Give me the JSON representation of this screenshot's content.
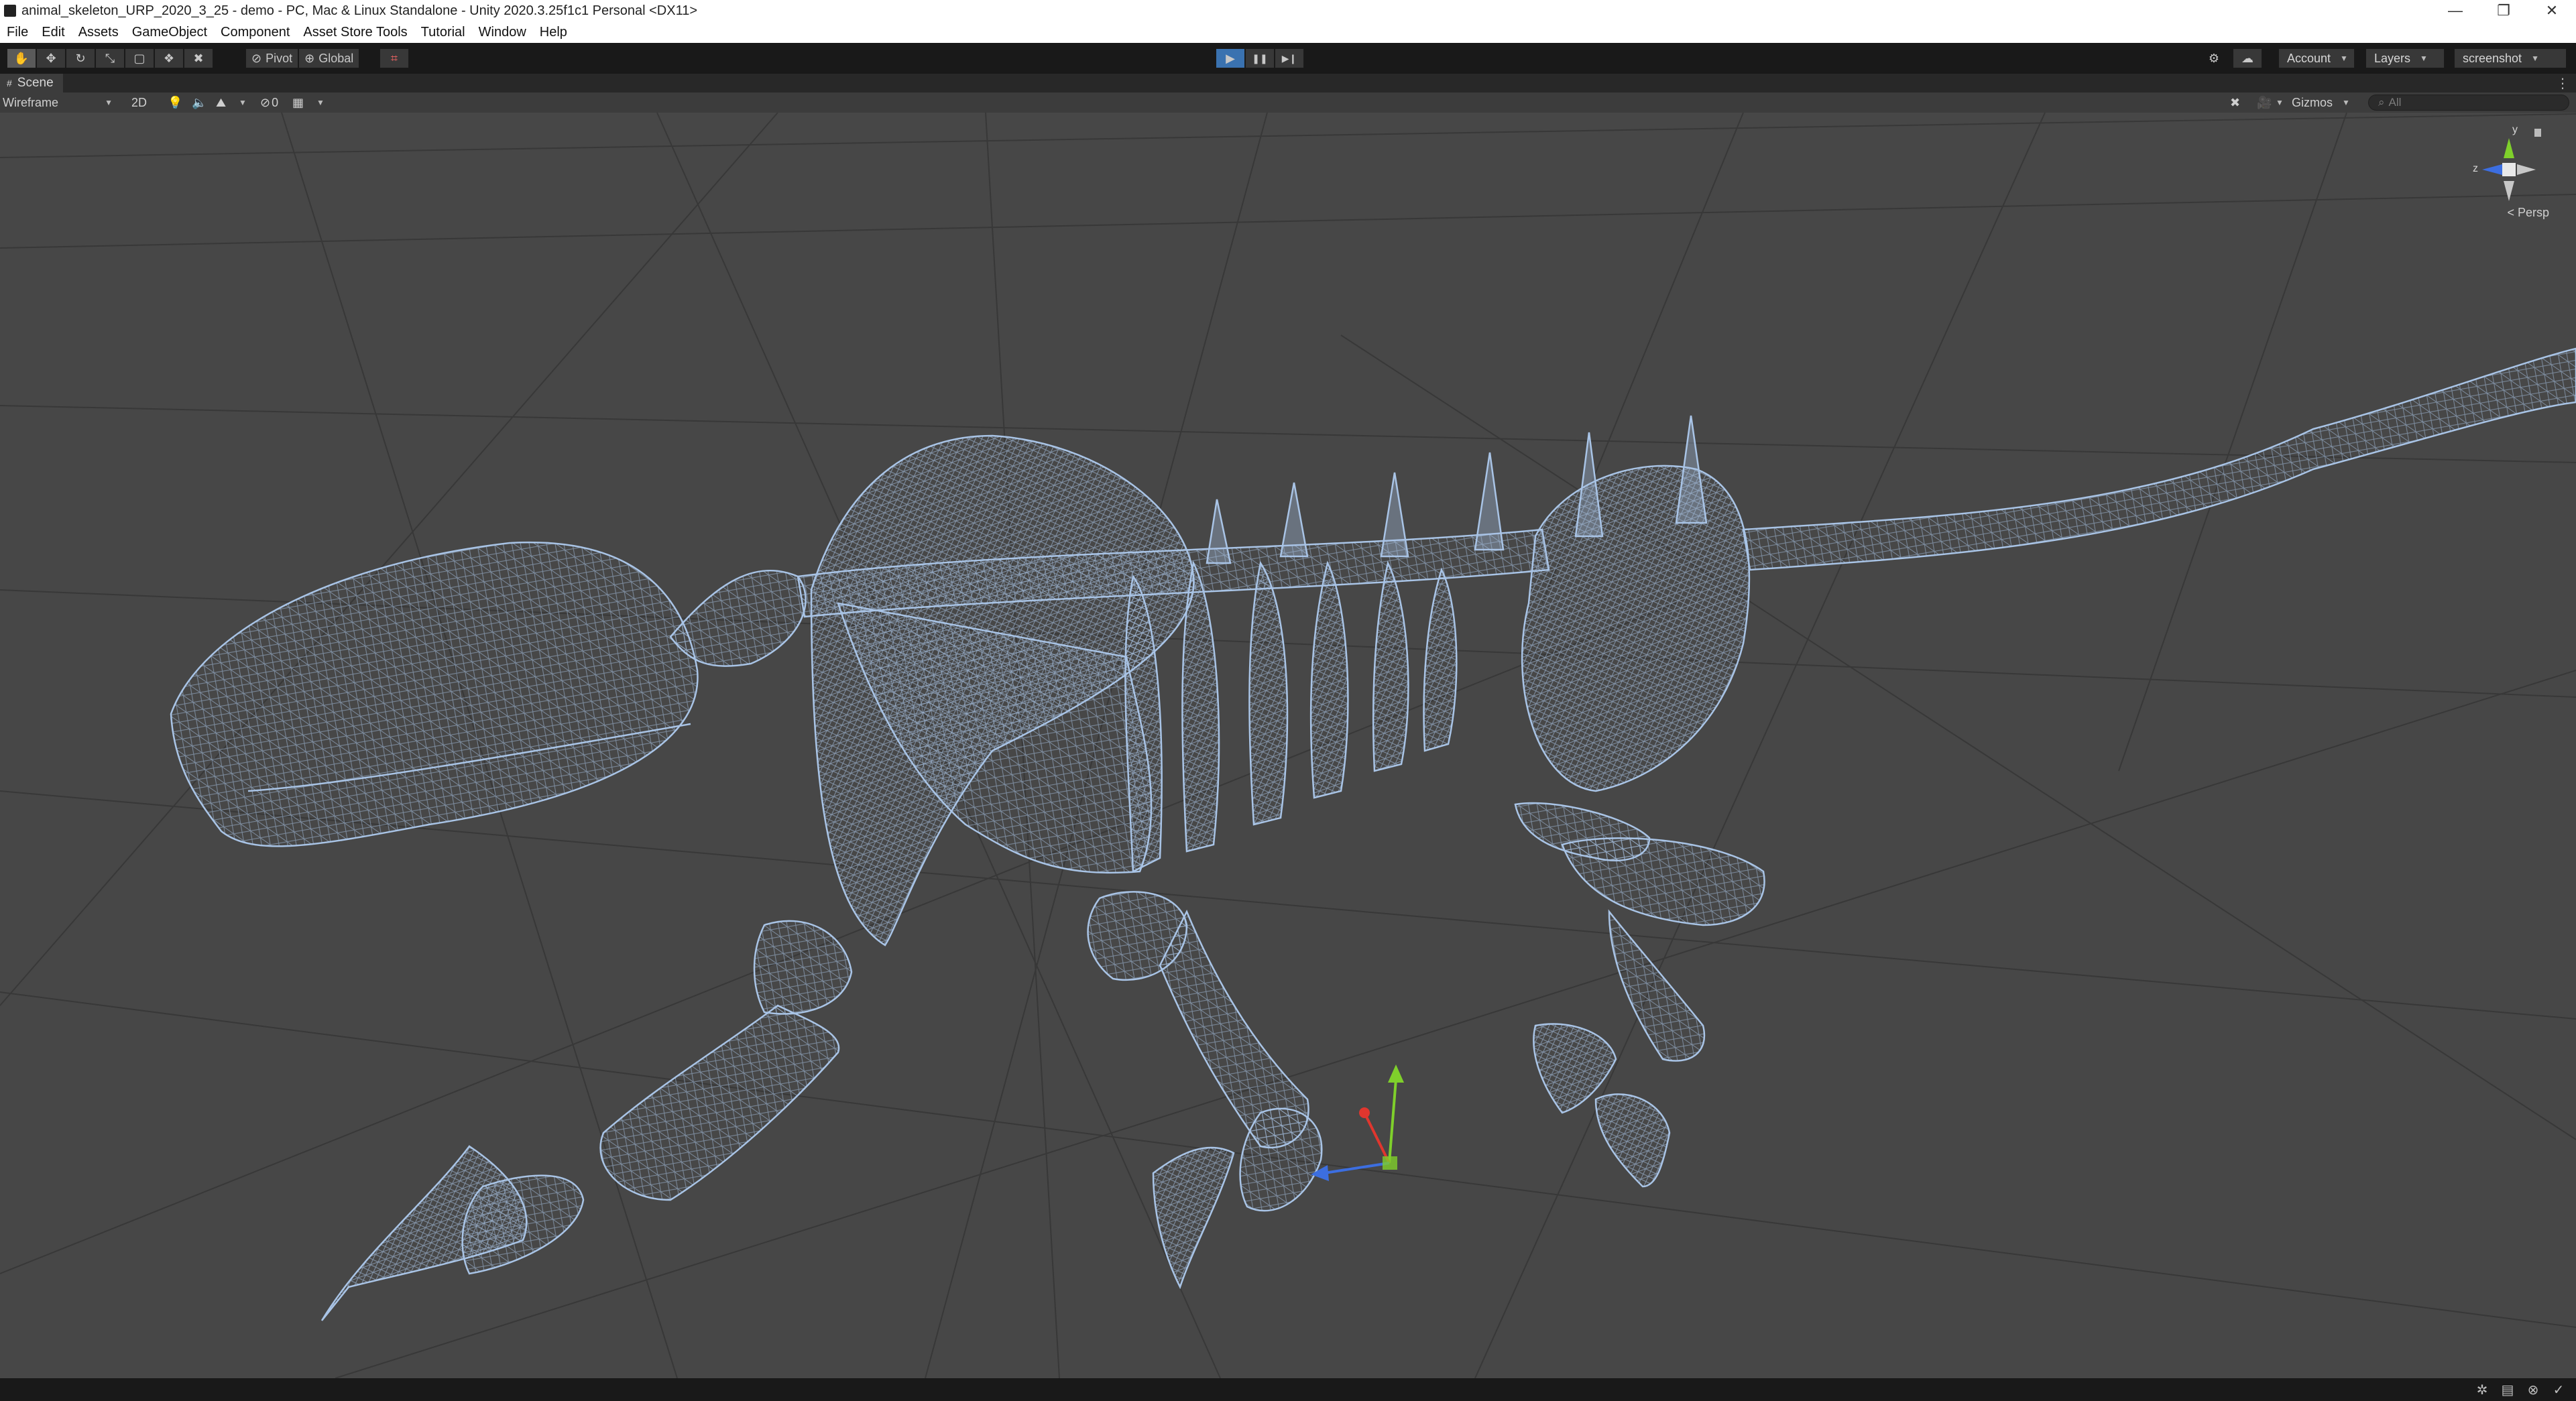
{
  "window": {
    "title": "animal_skeleton_URP_2020_3_25 - demo - PC, Mac & Linux Standalone - Unity 2020.3.25f1c1 Personal <DX11>",
    "minimize": "—",
    "restore": "❐",
    "close": "✕"
  },
  "menu": [
    "File",
    "Edit",
    "Assets",
    "GameObject",
    "Component",
    "Asset Store Tools",
    "Tutorial",
    "Window",
    "Help"
  ],
  "toolbar": {
    "tools": [
      {
        "icon": "hand-icon",
        "glyph": "✋"
      },
      {
        "icon": "move-icon",
        "glyph": "✥"
      },
      {
        "icon": "rotate-icon",
        "glyph": "↻"
      },
      {
        "icon": "scale-icon",
        "glyph": "⤡"
      },
      {
        "icon": "rect-icon",
        "glyph": "▢"
      },
      {
        "icon": "transform-icon",
        "glyph": "❖"
      },
      {
        "icon": "custom-tool-icon",
        "glyph": "✖"
      }
    ],
    "pivot_label": "Pivot",
    "global_label": "Global",
    "snap_icon": "grid-snap-icon",
    "play_glyph": "▶",
    "pause_glyph": "❚❚",
    "step_glyph": "▶❙",
    "account_label": "Account",
    "layers_label": "Layers",
    "layout_label": "screenshot"
  },
  "scene_tab": {
    "label": "Scene",
    "draw_mode": "Wireframe",
    "toggle_2d": "2D",
    "hidden_count": "0",
    "gizmos_label": "Gizmos",
    "search_placeholder": "All",
    "persp_label": "< Persp",
    "axis_y": "y",
    "axis_z": "z"
  },
  "colors": {
    "axis_x": "#e0362e",
    "axis_y": "#7fd02b",
    "axis_z": "#3c6ee0",
    "wireframe": "#a9c4e6",
    "play_active": "#3a72b0"
  }
}
